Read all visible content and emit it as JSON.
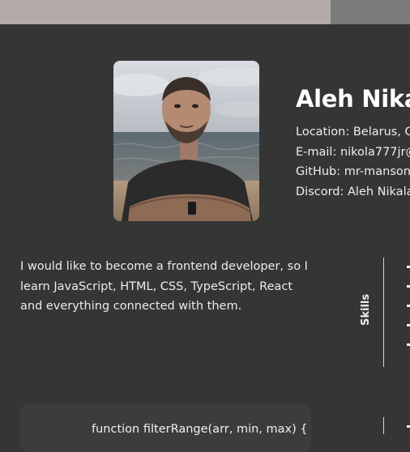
{
  "profile": {
    "name": "Aleh Nika",
    "contacts": [
      "Location: Belarus, G",
      "E-mail: nikola777jr@",
      "GitHub: mr-manson",
      "Discord: Aleh Nikala"
    ]
  },
  "about": {
    "text": "I would like to become a frontend developer, so I learn JavaScript, HTML, CSS, TypeScript, React and everything connected with them."
  },
  "skills": {
    "label": "Skills"
  },
  "code": {
    "first_line": "function filterRange(arr, min, max) {"
  },
  "colors": {
    "background": "#353535",
    "topbar_left": "#b4aaa9",
    "topbar_right": "#7b7b7b"
  }
}
